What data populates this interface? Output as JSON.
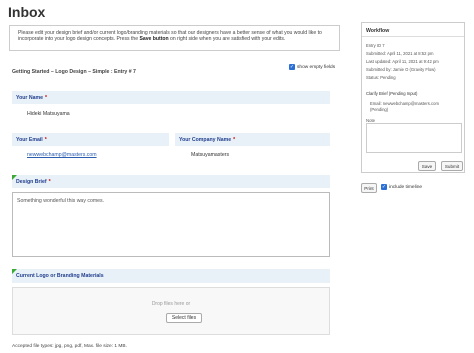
{
  "page": {
    "title": "Inbox"
  },
  "notice": {
    "line1": "Please edit your design brief and/or current logo/branding materials so that our designers have a better sense of what you would",
    "line2_pre": "like to incorporate into your logo design concepts. Press the ",
    "line2_bold": "Save button",
    "line2_post": " on right side when you are satisfied with your edits."
  },
  "entry": {
    "title": "Getting Started – Logo Design – Simple : Entry # 7",
    "show_empty_label": "show empty fields",
    "show_empty_checked": true
  },
  "fields": {
    "name": {
      "label": "Your Name",
      "required": "*",
      "value": "Hideki Matsuyama"
    },
    "email": {
      "label": "Your Email",
      "required": "*",
      "value": "newwebchamp@masters.com"
    },
    "company": {
      "label": "Your Company Name",
      "required": "*",
      "value": "Matsuyamasters"
    },
    "brief": {
      "label": "Design Brief",
      "required": "*",
      "value": "Something wonderful this way comes."
    },
    "logo": {
      "label": "Current Logo or Branding Materials",
      "drop_text": "Drop files here or",
      "select_label": "Select files",
      "accepted": "Accepted file types: jpg, png, pdf, Max. file size: 1 MB."
    }
  },
  "workflow": {
    "title": "Workflow",
    "entry_id": "Entry ID 7",
    "submitted": "Submitted: April 11, 2021 at 8:52 pm",
    "last_updated": "Last updated: April 11, 2021 at 9:42 pm",
    "submitted_by": "Submitted by: Jamie O (Gravity Flow)",
    "status": "Status: Pending",
    "step": "Clarify Brief (Pending Input)",
    "email": "Email: newwebchamp@masters.com",
    "email_status": "(Pending)",
    "note_label": "Note",
    "save_label": "Save",
    "submit_label": "Submit"
  },
  "actions": {
    "print_label": "Print",
    "include_timeline_label": "include timeline",
    "include_timeline_checked": true
  },
  "colors": {
    "field_header_bg": "#e8f0f8",
    "field_header_text": "#23408e",
    "link": "#2a5db0",
    "checkbox": "#2b6fd6",
    "corner_marker": "#3aaa35"
  }
}
